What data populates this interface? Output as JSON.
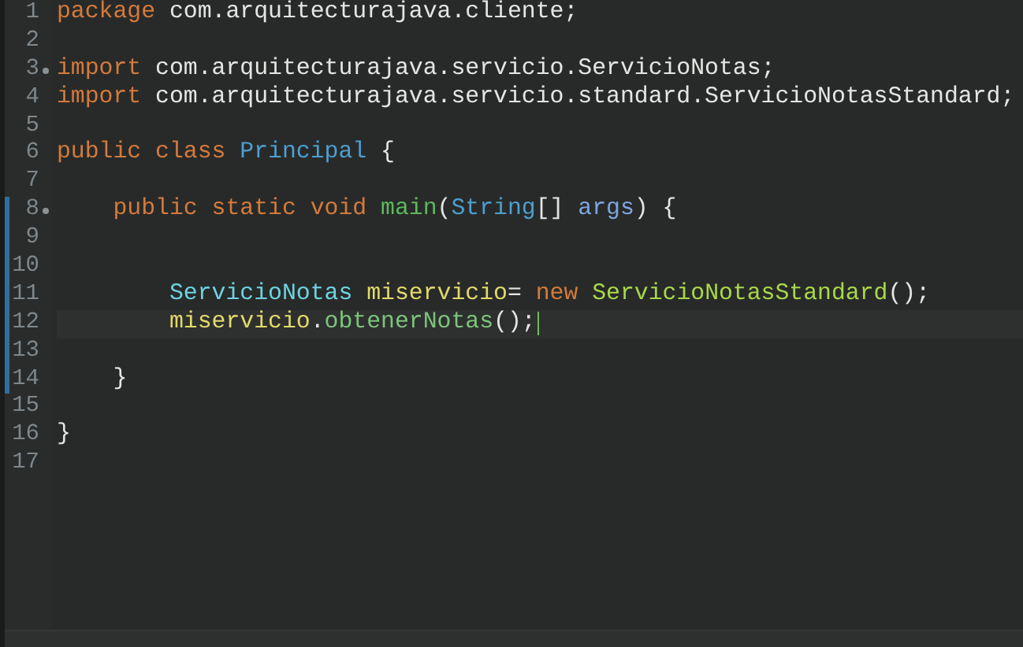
{
  "editor": {
    "lines": [
      {
        "number": "1",
        "fold_marker": false,
        "changed": false,
        "current": false,
        "tokens": [
          {
            "kind": "keyword",
            "text": "package"
          },
          {
            "kind": "plain",
            "text": " com.arquitecturajava.cliente;"
          }
        ]
      },
      {
        "number": "2",
        "fold_marker": false,
        "changed": false,
        "current": false
      },
      {
        "number": "3",
        "fold_marker": true,
        "changed": false,
        "current": false,
        "tokens": [
          {
            "kind": "keyword",
            "text": "import"
          },
          {
            "kind": "plain",
            "text": " com.arquitecturajava.servicio.ServicioNotas;"
          }
        ]
      },
      {
        "number": "4",
        "fold_marker": false,
        "changed": false,
        "current": false,
        "tokens": [
          {
            "kind": "keyword",
            "text": "import"
          },
          {
            "kind": "plain",
            "text": " com.arquitecturajava.servicio.standard.ServicioNotasStandard;"
          }
        ]
      },
      {
        "number": "5",
        "fold_marker": false,
        "changed": false,
        "current": false
      },
      {
        "number": "6",
        "fold_marker": false,
        "changed": false,
        "current": false,
        "tokens": [
          {
            "kind": "keyword",
            "text": "public class "
          },
          {
            "kind": "class",
            "text": "Principal"
          },
          {
            "kind": "plain",
            "text": " {"
          }
        ]
      },
      {
        "number": "7",
        "fold_marker": false,
        "changed": false,
        "current": false
      },
      {
        "number": "8",
        "fold_marker": true,
        "changed": true,
        "current": false,
        "tokens": [
          {
            "kind": "keyword",
            "text": "    public static void "
          },
          {
            "kind": "method",
            "text": "main"
          },
          {
            "kind": "plain",
            "text": "("
          },
          {
            "kind": "class",
            "text": "String"
          },
          {
            "kind": "plain",
            "text": "[] "
          },
          {
            "kind": "param",
            "text": "args"
          },
          {
            "kind": "plain",
            "text": ") {"
          }
        ]
      },
      {
        "number": "9",
        "fold_marker": false,
        "changed": true,
        "current": false
      },
      {
        "number": "10",
        "fold_marker": false,
        "changed": true,
        "current": false
      },
      {
        "number": "11",
        "fold_marker": false,
        "changed": true,
        "current": false,
        "tokens": [
          {
            "kind": "type",
            "text": "        ServicioNotas "
          },
          {
            "kind": "variable",
            "text": "miservicio"
          },
          {
            "kind": "plain",
            "text": "= "
          },
          {
            "kind": "keyword",
            "text": "new "
          },
          {
            "kind": "constructor",
            "text": "ServicioNotasStandard"
          },
          {
            "kind": "plain",
            "text": "();"
          }
        ]
      },
      {
        "number": "12",
        "fold_marker": false,
        "changed": true,
        "current": true,
        "tokens": [
          {
            "kind": "variable",
            "text": "        miservicio"
          },
          {
            "kind": "plain",
            "text": "."
          },
          {
            "kind": "call",
            "text": "obtenerNotas"
          },
          {
            "kind": "plain",
            "text": "();"
          }
        ]
      },
      {
        "number": "13",
        "fold_marker": false,
        "changed": true,
        "current": false
      },
      {
        "number": "14",
        "fold_marker": false,
        "changed": true,
        "current": false,
        "tokens": [
          {
            "kind": "plain",
            "text": "    }"
          }
        ]
      },
      {
        "number": "15",
        "fold_marker": false,
        "changed": false,
        "current": false
      },
      {
        "number": "16",
        "fold_marker": false,
        "changed": false,
        "current": false,
        "tokens": [
          {
            "kind": "plain",
            "text": "}"
          }
        ]
      },
      {
        "number": "17",
        "fold_marker": false,
        "changed": false,
        "current": false
      }
    ]
  }
}
